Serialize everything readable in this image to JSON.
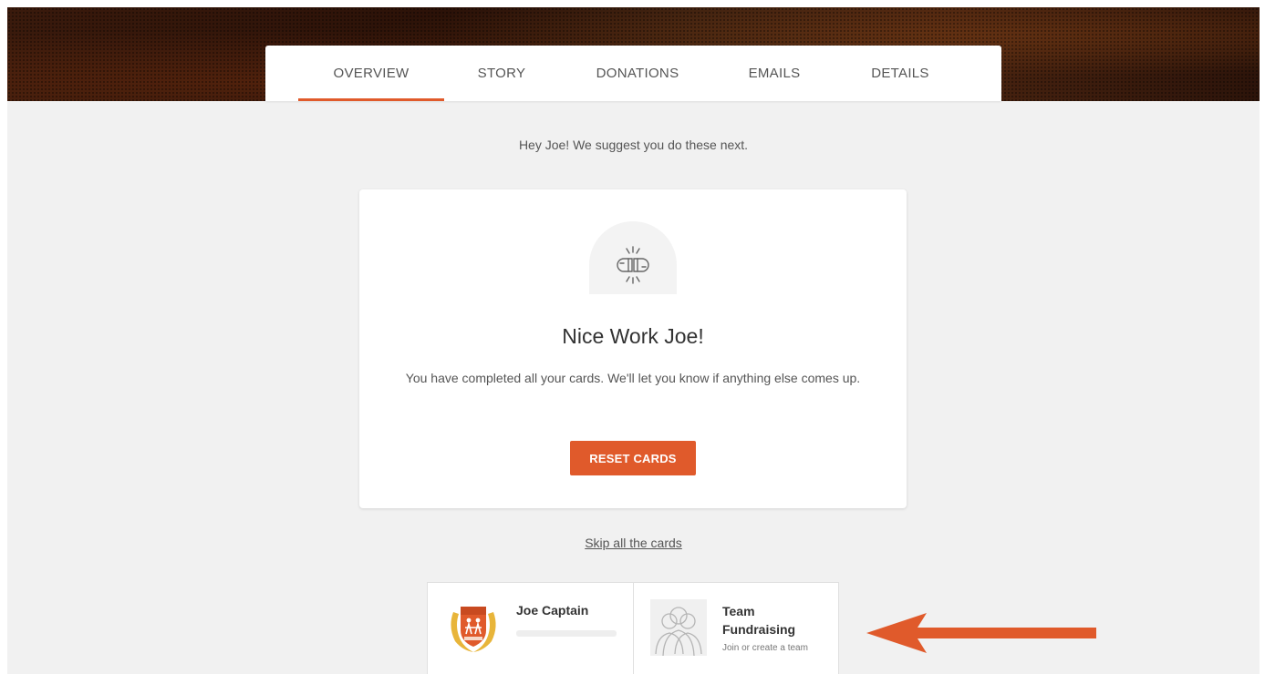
{
  "tabs": [
    {
      "label": "OVERVIEW",
      "active": true
    },
    {
      "label": "STORY",
      "active": false
    },
    {
      "label": "DONATIONS",
      "active": false
    },
    {
      "label": "EMAILS",
      "active": false
    },
    {
      "label": "DETAILS",
      "active": false
    }
  ],
  "suggestion": "Hey Joe! We suggest you do these next.",
  "card": {
    "icon": "fist-bump-icon",
    "title": "Nice Work Joe!",
    "text": "You have completed all your cards. We'll let you know if anything else comes up.",
    "button": "RESET CARDS"
  },
  "skip_link": "Skip all the cards",
  "mini_cards": {
    "captain": {
      "name": "Joe Captain",
      "icon": "team-crest-icon",
      "progress": 0
    },
    "team": {
      "title": "Team Fundraising",
      "subtitle": "Join or create a team",
      "icon": "people-group-icon"
    }
  },
  "annotation": {
    "icon": "arrow-left-icon",
    "color": "#e05a2b"
  },
  "colors": {
    "accent": "#e05a2b",
    "background": "#f1f1f1"
  }
}
